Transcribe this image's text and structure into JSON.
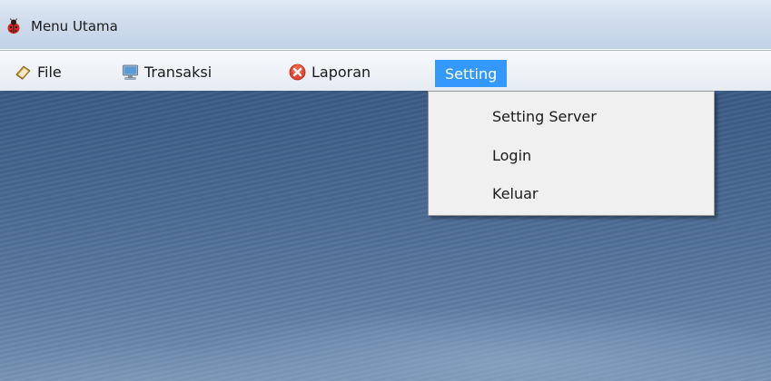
{
  "window": {
    "title": "Menu Utama",
    "icon": "ladybug-icon"
  },
  "menubar": {
    "items": [
      {
        "label": "File",
        "icon": "book-icon"
      },
      {
        "label": "Transaksi",
        "icon": "monitor-icon"
      },
      {
        "label": "Laporan",
        "icon": "red-x-circle-icon"
      },
      {
        "label": "Setting",
        "icon": "",
        "state": "open"
      }
    ]
  },
  "dropdown": {
    "parent": "Setting",
    "items": [
      {
        "label": "Setting Server"
      },
      {
        "label": "Login"
      },
      {
        "label": "Keluar"
      }
    ]
  },
  "colors": {
    "menu_highlight": "#3399ff",
    "content_background": "#4a6a93"
  }
}
